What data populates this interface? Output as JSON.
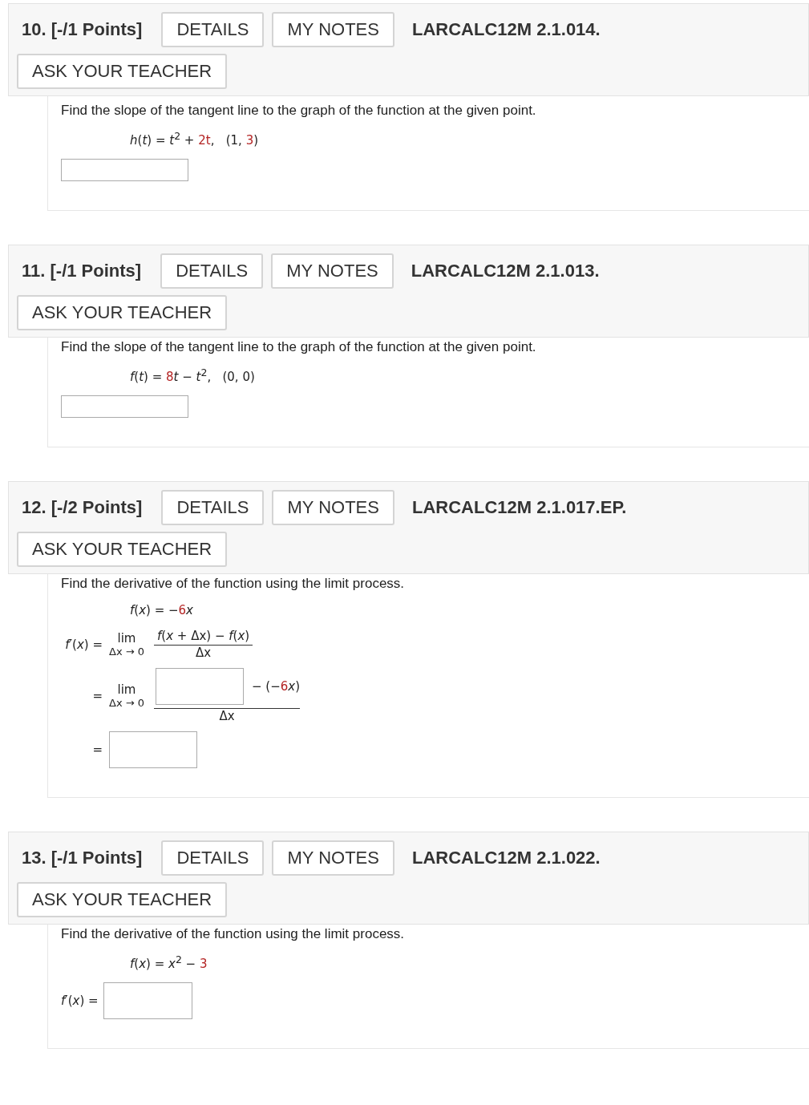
{
  "problems": [
    {
      "number": "10.",
      "points": "[-/1 Points]",
      "details": "DETAILS",
      "notes": "MY NOTES",
      "code": "LARCALC12M 2.1.014.",
      "ask": "ASK YOUR TEACHER",
      "prompt": "Find the slope of the tangent line to the graph of the function at the given point.",
      "formula": [
        {
          "text": "*h*(*t*) = *t*$^{2}$ + ",
          "highlight": false
        },
        {
          "text": "2t",
          "highlight": true
        },
        {
          "text": ",   (1, ",
          "highlight": false
        },
        {
          "text": "3",
          "highlight": true
        },
        {
          "text": ")",
          "highlight": false
        }
      ],
      "answer": {
        "kind": "box"
      }
    },
    {
      "number": "11.",
      "points": "[-/1 Points]",
      "details": "DETAILS",
      "notes": "MY NOTES",
      "code": "LARCALC12M 2.1.013.",
      "ask": "ASK YOUR TEACHER",
      "prompt": "Find the slope of the tangent line to the graph of the function at the given point.",
      "formula": [
        {
          "text": "*f*(*t*) = ",
          "highlight": false
        },
        {
          "text": "8",
          "highlight": true
        },
        {
          "text": "*t* − *t*$^{2}$,   (0, 0)",
          "highlight": false
        }
      ],
      "answer": {
        "kind": "box"
      }
    },
    {
      "number": "12.",
      "points": "[-/2 Points]",
      "details": "DETAILS",
      "notes": "MY NOTES",
      "code": "LARCALC12M 2.1.017.EP.",
      "ask": "ASK YOUR TEACHER",
      "prompt": "Find the derivative of the function using the limit process.",
      "formula": [
        {
          "text": "*f*(*x*) = −",
          "highlight": false
        },
        {
          "text": "6",
          "highlight": true
        },
        {
          "text": "*x*",
          "highlight": false
        }
      ],
      "answer": {
        "kind": "limit",
        "lhs": "*f*′(*x*) =",
        "lim": "lim",
        "under": "Δx → 0",
        "numerator": "*f*(*x* + Δx) − *f*(*x*)",
        "denominator": "Δx",
        "eq2": "=",
        "lim2": "lim",
        "under2": "Δx → 0",
        "rest": [
          {
            "text": "− (−",
            "highlight": false
          },
          {
            "text": "6",
            "highlight": true
          },
          {
            "text": "*x*)",
            "highlight": false
          }
        ],
        "denominator2": "Δx",
        "eq3": "="
      }
    },
    {
      "number": "13.",
      "points": "[-/1 Points]",
      "details": "DETAILS",
      "notes": "MY NOTES",
      "code": "LARCALC12M 2.1.022.",
      "ask": "ASK YOUR TEACHER",
      "prompt": "Find the derivative of the function using the limit process.",
      "formula": [
        {
          "text": "*f*(*x*) = *x*$^{2}$ − ",
          "highlight": false
        },
        {
          "text": "3",
          "highlight": true
        }
      ],
      "answer": {
        "kind": "labeled",
        "label": "*f*′(*x*) ="
      }
    }
  ]
}
